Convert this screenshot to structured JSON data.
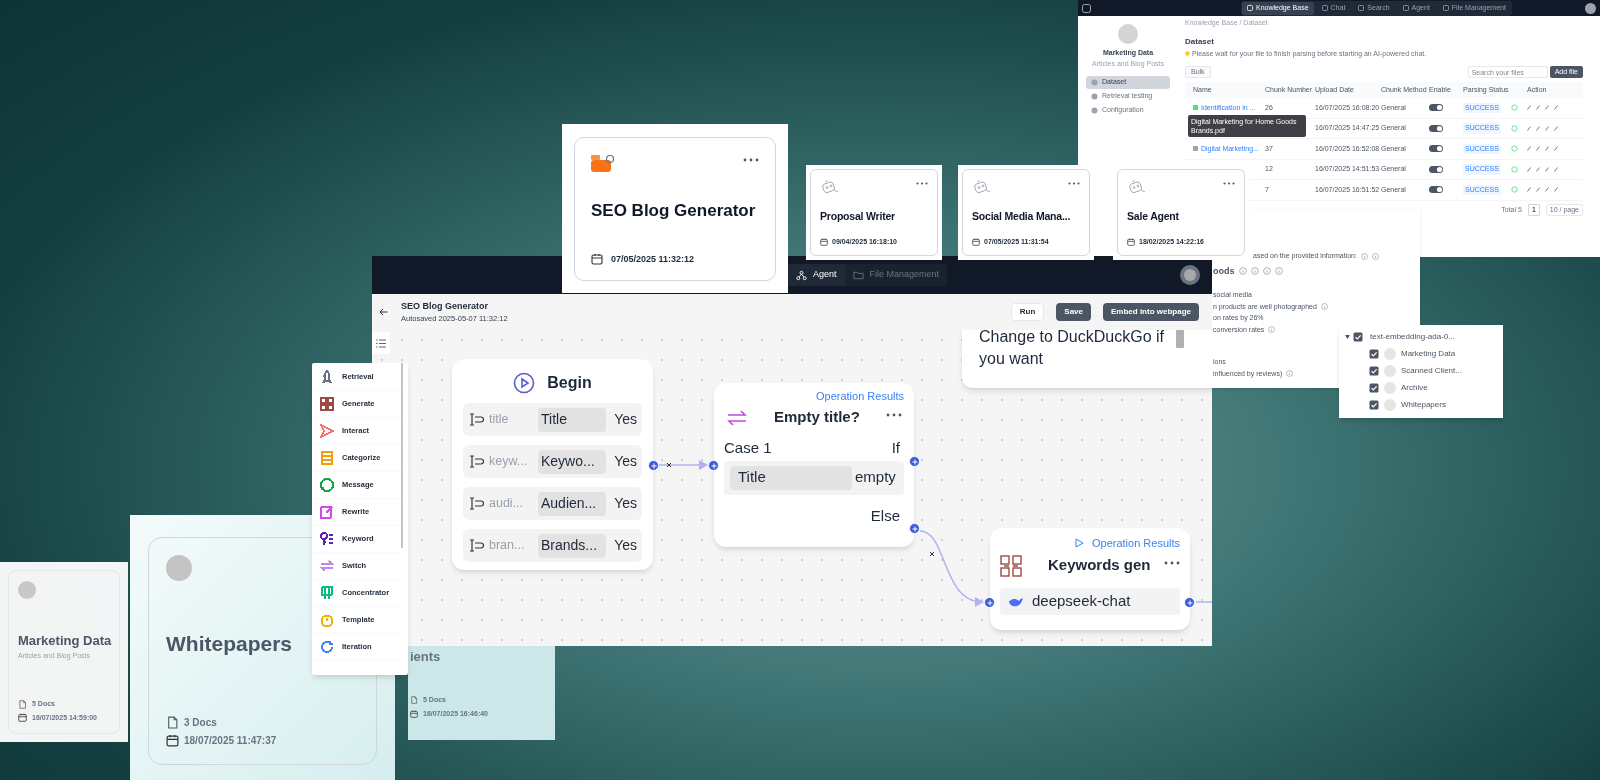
{
  "dataset_window": {
    "nav": [
      {
        "label": "Knowledge Base",
        "selected": true
      },
      {
        "label": "Chat",
        "selected": false
      },
      {
        "label": "Search",
        "selected": false
      },
      {
        "label": "Agent",
        "selected": false
      },
      {
        "label": "File Management",
        "selected": false
      }
    ],
    "breadcrumb": "Knowledge Base / Dataset",
    "kb": {
      "name": "Marketing Data",
      "description": "Articles and Blog Posts"
    },
    "sidebar": [
      {
        "label": "Dataset",
        "selected": true
      },
      {
        "label": "Retrieval testing",
        "selected": false
      },
      {
        "label": "Configuration",
        "selected": false
      }
    ],
    "heading": "Dataset",
    "notice": "Please wait for your file to finish parsing before starting an AI-powered chat.",
    "bulk_button": "Bulk",
    "search": {
      "placeholder": "Search your files"
    },
    "add_button": "Add file",
    "columns": [
      "Name",
      "Chunk Number",
      "Upload Date",
      "Chunk Method",
      "Enable",
      "Parsing Status",
      "Action"
    ],
    "rows": [
      {
        "name": "Identification in ...",
        "chunks": "26",
        "upload_date": "16/07/2025 16:08:20",
        "method": "General",
        "enabled": true,
        "status": "SUCCESS"
      },
      {
        "upload_date": "16/07/2025 14:47:25",
        "method": "General",
        "enabled": true,
        "status": "SUCCESS"
      },
      {
        "name": "Digital Marketing...",
        "chunks": "37",
        "upload_date": "16/07/2025 16:52:08",
        "method": "General",
        "enabled": true,
        "status": "SUCCESS"
      },
      {
        "chunks": "12",
        "upload_date": "16/07/2025 14:51:53",
        "method": "General",
        "enabled": true,
        "status": "SUCCESS"
      },
      {
        "chunks": "7",
        "upload_date": "16/07/2025 16:51:52",
        "method": "General",
        "enabled": true,
        "status": "SUCCESS"
      }
    ],
    "tooltip": "Digital Marketing for Home Goods Brands.pdf",
    "pagination": {
      "total": "Total 5",
      "page": "1",
      "page_size": "10 / page"
    }
  },
  "chat_panel": {
    "lines": [
      {
        "text": "ased on the provided information:",
        "kind": "note"
      },
      {
        "text": "oods",
        "kind": "heading"
      },
      {
        "text": "social media",
        "kind": "item",
        "info": false
      },
      {
        "text": "n products are well photographed",
        "kind": "item",
        "info": true
      },
      {
        "text": "on rates by 26%",
        "kind": "item",
        "info": false
      },
      {
        "text": "conversion rates",
        "kind": "item",
        "info": true
      },
      {
        "text": "ions",
        "kind": "item",
        "info": false
      },
      {
        "text": "influenced by reviews)",
        "kind": "item",
        "info": true
      }
    ]
  },
  "tree_popup": {
    "label": "text-embedding-ada-0...",
    "checked": true,
    "expanded": true,
    "children": [
      {
        "label": "Marketing Data",
        "checked": true
      },
      {
        "label": "Scanned Client...",
        "checked": true
      },
      {
        "label": "Archive",
        "checked": true
      },
      {
        "label": "Whitepapers",
        "checked": true
      }
    ]
  },
  "knowledge_cards": [
    {
      "title": "Marketing Data",
      "description": "Articles and Blog Posts",
      "docs": "5 Docs",
      "date": "16/07/2025 14:59:00"
    },
    {
      "title": "Whitepapers",
      "docs": "3 Docs",
      "date": "18/07/2025 11:47:37"
    },
    {
      "title": "ients",
      "docs": "5 Docs",
      "date": "16/07/2025 16:46:40"
    }
  ],
  "agent_window": {
    "nav": [
      {
        "label": "Agent",
        "selected": true
      },
      {
        "label": "File Management",
        "selected": false
      }
    ],
    "title": "SEO Blog Generator",
    "autosave": "Autosaved 2025-05-07 11:32:12",
    "buttons": [
      {
        "label": "Run",
        "kind": "outline"
      },
      {
        "label": "Save",
        "kind": "solid"
      },
      {
        "label": "Embed into webpage",
        "kind": "solid"
      }
    ],
    "note": "Change to DuckDuckGo if you want",
    "nodes": [
      {
        "kind": "begin",
        "title": "Begin",
        "fields": [
          {
            "name": "title",
            "label": "Title",
            "required": "Yes"
          },
          {
            "name": "keyw...",
            "label": "Keywo...",
            "required": "Yes"
          },
          {
            "name": "audi...",
            "label": "Audien...",
            "required": "Yes"
          },
          {
            "name": "bran...",
            "label": "Brands...",
            "required": "Yes"
          }
        ]
      },
      {
        "kind": "switch",
        "title": "Empty title?",
        "results_link": "Operation Results",
        "case": "Case 1",
        "if_label": "If",
        "condition": {
          "field": "Title",
          "operator": "empty"
        },
        "else_label": "Else"
      },
      {
        "kind": "generate",
        "title": "Keywords gen",
        "results_link": "Operation Results",
        "model": "deepseek-chat"
      }
    ]
  },
  "operators": [
    {
      "label": "Retrieval",
      "color": "#6b7280"
    },
    {
      "label": "Generate",
      "color": "#9f4a44"
    },
    {
      "label": "Interact",
      "color": "#f87171"
    },
    {
      "label": "Categorize",
      "color": "#f59e0b"
    },
    {
      "label": "Message",
      "color": "#16a34a"
    },
    {
      "label": "Rewrite",
      "color": "#d946ef"
    },
    {
      "label": "Keyword",
      "color": "#5b21b6"
    },
    {
      "label": "Switch",
      "color": "#c084fc"
    },
    {
      "label": "Concentrator",
      "color": "#10b981"
    },
    {
      "label": "Template",
      "color": "#eab308"
    },
    {
      "label": "Iteration",
      "color": "#3b82f6"
    }
  ],
  "agent_cards": [
    {
      "title": "SEO Blog Generator",
      "date": "07/05/2025 11:32:12",
      "kind": "featured"
    },
    {
      "title": "Proposal Writer",
      "date": "09/04/2025 16:18:10",
      "kind": "default"
    },
    {
      "title": "Social Media Mana...",
      "date": "07/05/2025 11:31:54",
      "kind": "default"
    },
    {
      "title": "Sale Agent",
      "date": "18/02/2025 14:22:16",
      "kind": "default"
    }
  ]
}
